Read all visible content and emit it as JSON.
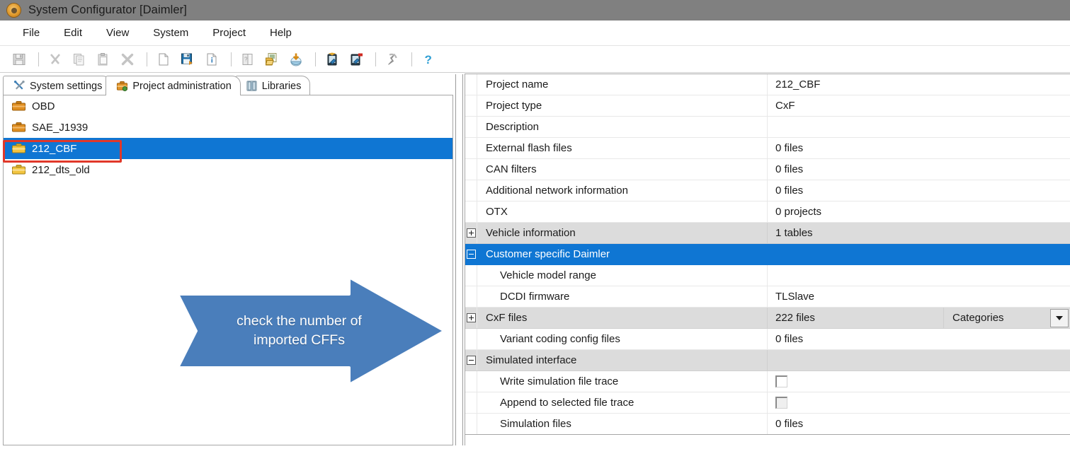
{
  "window": {
    "title": "System Configurator [Daimler]",
    "app_icon": "gear-icon",
    "titlebar_color": "#808080"
  },
  "menu": {
    "items": [
      {
        "label": "File"
      },
      {
        "label": "Edit"
      },
      {
        "label": "View"
      },
      {
        "label": "System"
      },
      {
        "label": "Project"
      },
      {
        "label": "Help"
      }
    ]
  },
  "toolbar": {
    "buttons": [
      {
        "icon": "save-icon",
        "enabled": false
      },
      {
        "sep": true
      },
      {
        "icon": "cut-icon",
        "enabled": false
      },
      {
        "icon": "copy-icon",
        "enabled": false
      },
      {
        "icon": "paste-icon",
        "enabled": false
      },
      {
        "icon": "delete-icon",
        "enabled": false
      },
      {
        "sep": true
      },
      {
        "icon": "new-document-icon",
        "enabled": true
      },
      {
        "icon": "save-project-icon",
        "enabled": true
      },
      {
        "icon": "document-info-icon",
        "enabled": true
      },
      {
        "sep": true
      },
      {
        "icon": "book-page-icon",
        "enabled": false
      },
      {
        "icon": "open-folder-list-icon",
        "enabled": true
      },
      {
        "icon": "import-download-icon",
        "enabled": true
      },
      {
        "sep": true
      },
      {
        "icon": "device-edit-icon",
        "enabled": true
      },
      {
        "icon": "device-remove-icon",
        "enabled": true
      },
      {
        "sep": true
      },
      {
        "icon": "refresh-icon",
        "enabled": true
      },
      {
        "sep": true
      },
      {
        "icon": "help-icon",
        "enabled": true
      }
    ]
  },
  "tabs": {
    "items": [
      {
        "label": "System settings",
        "icon": "tools-icon",
        "active": false
      },
      {
        "label": "Project administration",
        "icon": "project-folder-icon",
        "active": true
      },
      {
        "label": "Libraries",
        "icon": "book-icon",
        "active": false
      }
    ]
  },
  "tree": {
    "items": [
      {
        "label": "OBD",
        "icon": "orange-case-icon",
        "selected": false
      },
      {
        "label": "SAE_J1939",
        "icon": "orange-case-icon",
        "selected": false
      },
      {
        "label": "212_CBF",
        "icon": "yellow-case-icon",
        "selected": true
      },
      {
        "label": "212_dts_old",
        "icon": "yellow-case-icon",
        "selected": false
      }
    ],
    "highlight_color": "#e0382a",
    "selection_color": "#0f76d3"
  },
  "annotation": {
    "text_line1": "check the number of",
    "text_line2": "imported CFFs",
    "arrow_color": "#4a7ebb",
    "direction": "right"
  },
  "properties": {
    "rows": [
      {
        "name": "Project name",
        "value": "212_CBF",
        "type": "item",
        "indent": false
      },
      {
        "name": "Project type",
        "value": "CxF",
        "type": "item",
        "indent": false
      },
      {
        "name": "Description",
        "value": "",
        "type": "item",
        "indent": false
      },
      {
        "name": "External flash files",
        "value": "0 files",
        "type": "item",
        "indent": false
      },
      {
        "name": "CAN filters",
        "value": "0 files",
        "type": "item",
        "indent": false
      },
      {
        "name": "Additional network information",
        "value": "0 files",
        "type": "item",
        "indent": false
      },
      {
        "name": "OTX",
        "value": "0 projects",
        "type": "item",
        "indent": false
      },
      {
        "name": "Vehicle information",
        "value": "1 tables",
        "type": "group",
        "expander": "plus"
      },
      {
        "name": "Customer specific Daimler",
        "value": "",
        "type": "group-selected",
        "expander": "minus"
      },
      {
        "name": "Vehicle model range",
        "value": "",
        "type": "item",
        "indent": true
      },
      {
        "name": "DCDI firmware",
        "value": "TLSlave",
        "type": "item",
        "indent": true
      },
      {
        "name": "CxF files",
        "value": "222 files",
        "type": "group",
        "expander": "plus",
        "extra_value": "Categories",
        "extra_control": "dropdown"
      },
      {
        "name": "Variant coding config files",
        "value": "0 files",
        "type": "item",
        "indent": true
      },
      {
        "name": "Simulated interface",
        "value": "",
        "type": "group",
        "expander": "minus"
      },
      {
        "name": "Write simulation file trace",
        "value": "",
        "type": "checkbox",
        "checked": false,
        "disabled": false,
        "indent": true
      },
      {
        "name": "Append to selected file trace",
        "value": "",
        "type": "checkbox",
        "checked": false,
        "disabled": true,
        "indent": true
      },
      {
        "name": "Simulation files",
        "value": "0 files",
        "type": "item",
        "indent": true
      }
    ]
  }
}
